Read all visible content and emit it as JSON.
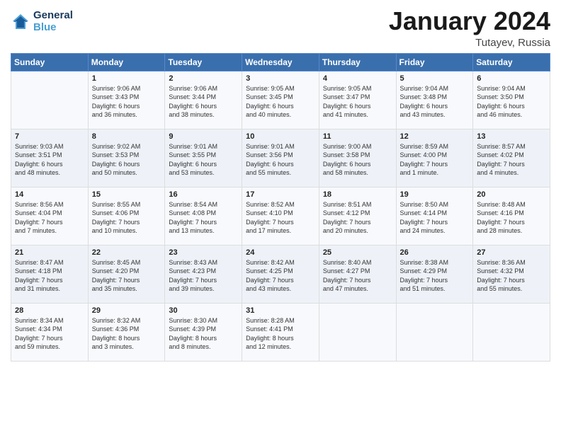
{
  "header": {
    "logo_line1": "General",
    "logo_line2": "Blue",
    "month": "January 2024",
    "location": "Tutayev, Russia"
  },
  "days_of_week": [
    "Sunday",
    "Monday",
    "Tuesday",
    "Wednesday",
    "Thursday",
    "Friday",
    "Saturday"
  ],
  "weeks": [
    [
      {
        "day": "",
        "info": ""
      },
      {
        "day": "1",
        "info": "Sunrise: 9:06 AM\nSunset: 3:43 PM\nDaylight: 6 hours\nand 36 minutes."
      },
      {
        "day": "2",
        "info": "Sunrise: 9:06 AM\nSunset: 3:44 PM\nDaylight: 6 hours\nand 38 minutes."
      },
      {
        "day": "3",
        "info": "Sunrise: 9:05 AM\nSunset: 3:45 PM\nDaylight: 6 hours\nand 40 minutes."
      },
      {
        "day": "4",
        "info": "Sunrise: 9:05 AM\nSunset: 3:47 PM\nDaylight: 6 hours\nand 41 minutes."
      },
      {
        "day": "5",
        "info": "Sunrise: 9:04 AM\nSunset: 3:48 PM\nDaylight: 6 hours\nand 43 minutes."
      },
      {
        "day": "6",
        "info": "Sunrise: 9:04 AM\nSunset: 3:50 PM\nDaylight: 6 hours\nand 46 minutes."
      }
    ],
    [
      {
        "day": "7",
        "info": "Sunrise: 9:03 AM\nSunset: 3:51 PM\nDaylight: 6 hours\nand 48 minutes."
      },
      {
        "day": "8",
        "info": "Sunrise: 9:02 AM\nSunset: 3:53 PM\nDaylight: 6 hours\nand 50 minutes."
      },
      {
        "day": "9",
        "info": "Sunrise: 9:01 AM\nSunset: 3:55 PM\nDaylight: 6 hours\nand 53 minutes."
      },
      {
        "day": "10",
        "info": "Sunrise: 9:01 AM\nSunset: 3:56 PM\nDaylight: 6 hours\nand 55 minutes."
      },
      {
        "day": "11",
        "info": "Sunrise: 9:00 AM\nSunset: 3:58 PM\nDaylight: 6 hours\nand 58 minutes."
      },
      {
        "day": "12",
        "info": "Sunrise: 8:59 AM\nSunset: 4:00 PM\nDaylight: 7 hours\nand 1 minute."
      },
      {
        "day": "13",
        "info": "Sunrise: 8:57 AM\nSunset: 4:02 PM\nDaylight: 7 hours\nand 4 minutes."
      }
    ],
    [
      {
        "day": "14",
        "info": "Sunrise: 8:56 AM\nSunset: 4:04 PM\nDaylight: 7 hours\nand 7 minutes."
      },
      {
        "day": "15",
        "info": "Sunrise: 8:55 AM\nSunset: 4:06 PM\nDaylight: 7 hours\nand 10 minutes."
      },
      {
        "day": "16",
        "info": "Sunrise: 8:54 AM\nSunset: 4:08 PM\nDaylight: 7 hours\nand 13 minutes."
      },
      {
        "day": "17",
        "info": "Sunrise: 8:52 AM\nSunset: 4:10 PM\nDaylight: 7 hours\nand 17 minutes."
      },
      {
        "day": "18",
        "info": "Sunrise: 8:51 AM\nSunset: 4:12 PM\nDaylight: 7 hours\nand 20 minutes."
      },
      {
        "day": "19",
        "info": "Sunrise: 8:50 AM\nSunset: 4:14 PM\nDaylight: 7 hours\nand 24 minutes."
      },
      {
        "day": "20",
        "info": "Sunrise: 8:48 AM\nSunset: 4:16 PM\nDaylight: 7 hours\nand 28 minutes."
      }
    ],
    [
      {
        "day": "21",
        "info": "Sunrise: 8:47 AM\nSunset: 4:18 PM\nDaylight: 7 hours\nand 31 minutes."
      },
      {
        "day": "22",
        "info": "Sunrise: 8:45 AM\nSunset: 4:20 PM\nDaylight: 7 hours\nand 35 minutes."
      },
      {
        "day": "23",
        "info": "Sunrise: 8:43 AM\nSunset: 4:23 PM\nDaylight: 7 hours\nand 39 minutes."
      },
      {
        "day": "24",
        "info": "Sunrise: 8:42 AM\nSunset: 4:25 PM\nDaylight: 7 hours\nand 43 minutes."
      },
      {
        "day": "25",
        "info": "Sunrise: 8:40 AM\nSunset: 4:27 PM\nDaylight: 7 hours\nand 47 minutes."
      },
      {
        "day": "26",
        "info": "Sunrise: 8:38 AM\nSunset: 4:29 PM\nDaylight: 7 hours\nand 51 minutes."
      },
      {
        "day": "27",
        "info": "Sunrise: 8:36 AM\nSunset: 4:32 PM\nDaylight: 7 hours\nand 55 minutes."
      }
    ],
    [
      {
        "day": "28",
        "info": "Sunrise: 8:34 AM\nSunset: 4:34 PM\nDaylight: 7 hours\nand 59 minutes."
      },
      {
        "day": "29",
        "info": "Sunrise: 8:32 AM\nSunset: 4:36 PM\nDaylight: 8 hours\nand 3 minutes."
      },
      {
        "day": "30",
        "info": "Sunrise: 8:30 AM\nSunset: 4:39 PM\nDaylight: 8 hours\nand 8 minutes."
      },
      {
        "day": "31",
        "info": "Sunrise: 8:28 AM\nSunset: 4:41 PM\nDaylight: 8 hours\nand 12 minutes."
      },
      {
        "day": "",
        "info": ""
      },
      {
        "day": "",
        "info": ""
      },
      {
        "day": "",
        "info": ""
      }
    ]
  ]
}
